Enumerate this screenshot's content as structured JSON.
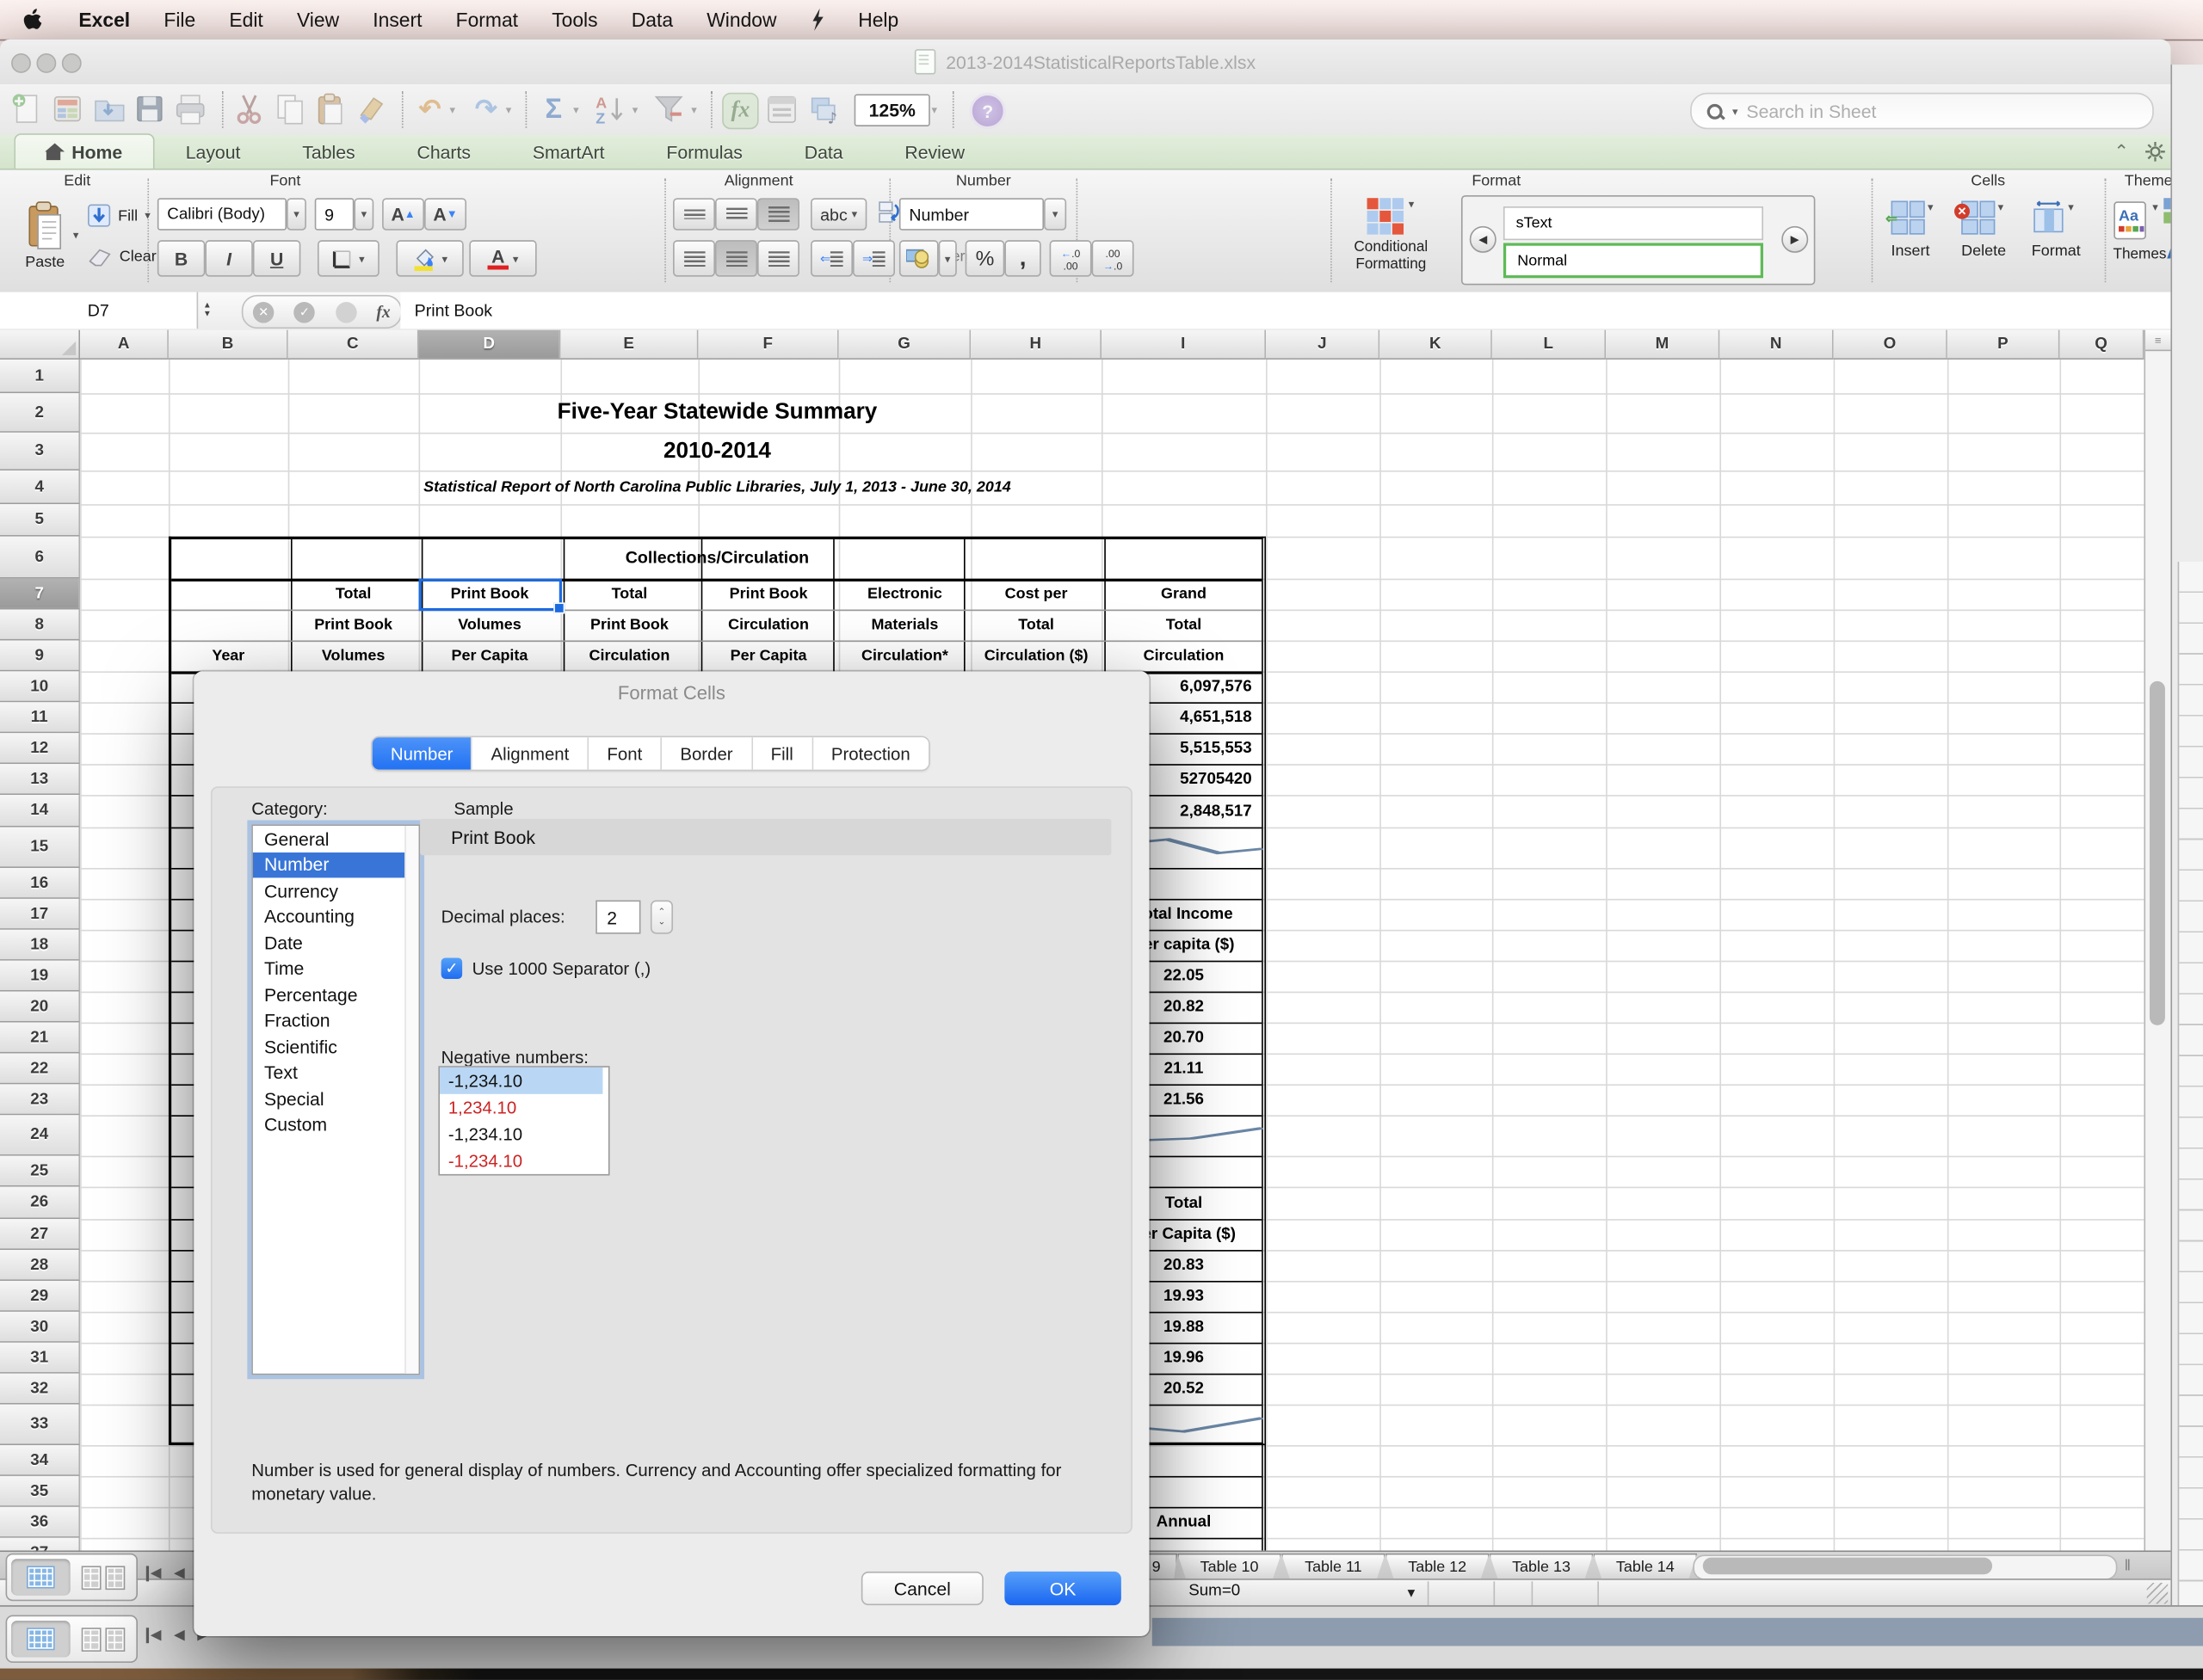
{
  "menu_bar": {
    "items": [
      "Excel",
      "File",
      "Edit",
      "View",
      "Insert",
      "Format",
      "Tools",
      "Data",
      "Window"
    ],
    "help": "Help"
  },
  "window": {
    "title": "2013-2014StatisticalReportsTable.xlsx",
    "zoom_level": "125%",
    "search_placeholder": "Search in Sheet"
  },
  "ribbon": {
    "tabs": [
      "Home",
      "Layout",
      "Tables",
      "Charts",
      "SmartArt",
      "Formulas",
      "Data",
      "Review"
    ],
    "active_tab": "Home",
    "groups": {
      "edit": {
        "title": "Edit",
        "paste": "Paste",
        "fill": "Fill",
        "clear": "Clear"
      },
      "font": {
        "title": "Font",
        "family": "Calibri (Body)",
        "size": "9",
        "bold": "B",
        "italic": "I",
        "underline": "U"
      },
      "alignment": {
        "title": "Alignment",
        "abc": "abc",
        "wrap": "Wrap Text",
        "merge": "Merge"
      },
      "number": {
        "title": "Number",
        "format": "Number",
        "percent": "%",
        "comma": ",",
        "dec_left": "←.0",
        "dec_left2": ".00",
        "dec_right": ".00",
        "dec_right2": "→.0"
      },
      "format": {
        "title": "Format",
        "conditional_line1": "Conditional",
        "conditional_line2": "Formatting",
        "styles": [
          "sText",
          "Normal"
        ]
      },
      "cells": {
        "title": "Cells",
        "insert": "Insert",
        "delete": "Delete",
        "format": "Format"
      },
      "themes": {
        "title": "Themes",
        "themes": "Themes",
        "fonts_aa": "Aa"
      }
    }
  },
  "formula_bar": {
    "cell_ref": "D7",
    "fx": "fx",
    "value": "Print Book"
  },
  "grid": {
    "columns": [
      "A",
      "B",
      "C",
      "D",
      "E",
      "F",
      "G",
      "H",
      "I",
      "J",
      "K",
      "L",
      "M",
      "N",
      "O",
      "P",
      "Q"
    ],
    "row_count": 37,
    "selected_col": "D",
    "selected_row": 7
  },
  "sheet": {
    "titles": [
      {
        "row": 2,
        "text": "Five-Year Statewide Summary"
      },
      {
        "row": 3,
        "text": "2010-2014"
      },
      {
        "row": 4,
        "text": "Statistical Report of North Carolina Public Libraries, July 1, 2013 - June 30, 2014"
      }
    ],
    "table_title": "Collections/Circulation",
    "header_rows": {
      "7": [
        "",
        "Total",
        "Print Book",
        "Total",
        "Print Book",
        "Electronic",
        "Cost per",
        "Grand"
      ],
      "8": [
        "",
        "Print Book",
        "Volumes",
        "Print Book",
        "Circulation",
        "Materials",
        "Total",
        "Total"
      ],
      "9": [
        "Year",
        "Volumes",
        "Per Capita",
        "Circulation",
        "Per Capita",
        "Circulation*",
        "Circulation ($)",
        "Circulation"
      ]
    },
    "col_i": {
      "10": "6,097,576",
      "11": "4,651,518",
      "12": "5,515,553",
      "13": "52705420",
      "14": "2,848,517",
      "17": "Total Income",
      "18": "Per capita ($)",
      "19": "22.05",
      "20": "20.82",
      "21": "20.70",
      "22": "21.11",
      "23": "21.56",
      "26": "Total",
      "27": "Per Capita ($)",
      "28": "20.83",
      "29": "19.93",
      "30": "19.88",
      "31": "19.96",
      "32": "20.52",
      "36": "Annual"
    },
    "sparklines": {
      "15": [
        [
          0,
          45
        ],
        [
          40,
          26
        ],
        [
          72,
          70
        ],
        [
          100,
          56
        ]
      ],
      "24": [
        [
          0,
          72
        ],
        [
          55,
          62
        ],
        [
          100,
          28
        ]
      ],
      "33": [
        [
          0,
          52
        ],
        [
          50,
          74
        ],
        [
          100,
          30
        ]
      ]
    }
  },
  "dialog": {
    "title": "Format Cells",
    "tabs": [
      "Number",
      "Alignment",
      "Font",
      "Border",
      "Fill",
      "Protection"
    ],
    "active_tab": "Number",
    "category_label": "Category:",
    "categories": [
      "General",
      "Number",
      "Currency",
      "Accounting",
      "Date",
      "Time",
      "Percentage",
      "Fraction",
      "Scientific",
      "Text",
      "Special",
      "Custom"
    ],
    "selected_category": "Number",
    "sample_label": "Sample",
    "sample_value": "Print Book",
    "decimal_label": "Decimal places:",
    "decimal_value": "2",
    "separator_label": "Use 1000 Separator (,)",
    "separator_checked": true,
    "negative_label": "Negative numbers:",
    "negative_options": [
      {
        "text": "-1,234.10",
        "color": "black",
        "selected": true
      },
      {
        "text": "1,234.10",
        "color": "red",
        "selected": false
      },
      {
        "text": "-1,234.10",
        "color": "black",
        "selected": false
      },
      {
        "text": "-1,234.10",
        "color": "red",
        "selected": false
      }
    ],
    "description": "Number is used for general display of numbers.  Currency and Accounting offer specialized formatting for monetary value.",
    "cancel": "Cancel",
    "ok": "OK"
  },
  "sheet_tabs": {
    "partial_left": "9",
    "tabs": [
      "Table 10",
      "Table 11",
      "Table 12",
      "Table 13",
      "Table 14"
    ]
  },
  "status_bar": {
    "summary": "Sum=0"
  },
  "ui_glyphs": {
    "dropdown": "▾",
    "left_arrow": "◀",
    "right_arrow": "▶",
    "check": "✓",
    "cancel_x": "✕",
    "sum": "Σ",
    "hamburger": "≡",
    "up": "▲",
    "down": "▼",
    "chevron_up": "⌃",
    "chevron_down": "⌄"
  },
  "colors": {
    "accent_blue": "#2f7cf6",
    "list_selection": "#3875d7",
    "negative_red": "#cc2222",
    "selection_border": "#1d6be0",
    "sparkline": "#6b87a6",
    "ribbon_green": "#d3e4cb",
    "menu_pink": "#f7ebe9"
  }
}
